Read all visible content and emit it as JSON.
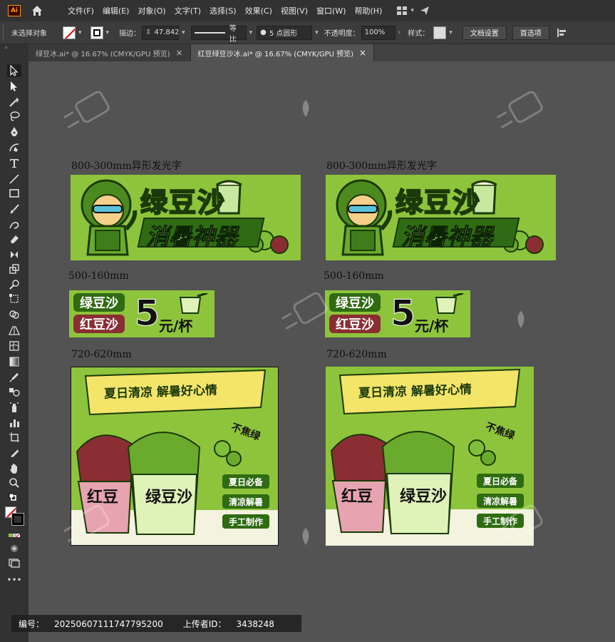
{
  "menubar": {
    "app_logo": "Ai",
    "items": [
      "文件(F)",
      "编辑(E)",
      "对象(O)",
      "文字(T)",
      "选择(S)",
      "效果(C)",
      "视图(V)",
      "窗口(W)",
      "帮助(H)"
    ]
  },
  "controlbar": {
    "selection_status": "未选择对象",
    "stroke_label": "描边：",
    "stroke_value": "47.842",
    "profile_label": "等比",
    "brush_label": "5 点圆形",
    "opacity_label": "不透明度：",
    "opacity_value": "100%",
    "style_label": "样式：",
    "doc_settings": "文档设置",
    "preferences": "首选项"
  },
  "tabs": [
    {
      "label": "绿豆冰.ai* @ 16.67% (CMYK/GPU 预览)",
      "close": "×"
    },
    {
      "label": "红豆绿豆沙冰.ai* @ 16.67% (CMYK/GPU 预览)",
      "close": "×"
    }
  ],
  "artwork": {
    "labels": {
      "banner_size_left": "800-300mm异形发光字",
      "banner_size_right": "800-300mm异形发光字",
      "small_size_left": "500-160mm",
      "small_size_right": "500-160mm",
      "poster_size_left": "720-620mm",
      "poster_size_right": "720-620mm"
    },
    "banner": {
      "title": "绿豆沙",
      "subtitle": "消暑神器"
    },
    "small_sign": {
      "line1": "绿豆沙",
      "line2": "红豆沙",
      "price": "5",
      "unit": "元/杯"
    },
    "poster": {
      "ribbon": "夏日清凉 解暑好心情",
      "tag": "不焦绿",
      "cup_red": "红豆",
      "cup_green": "绿豆沙",
      "features": [
        "夏日必备",
        "清凉解暑",
        "手工制作"
      ]
    }
  },
  "footer": {
    "id_label": "编号：",
    "id_value": "20250607111747795200",
    "uploader_label": "上传者ID：",
    "uploader_value": "3438248"
  },
  "colors": {
    "green": "#8ec43b",
    "dark_green": "#2f6b12",
    "red_bean": "#8a2e34",
    "ribbon_yellow": "#f3e46a"
  },
  "icons": [
    "home-icon",
    "arrange-icon",
    "selection-tool-icon",
    "direct-selection-tool-icon",
    "magic-wand-icon",
    "lasso-icon",
    "pen-icon",
    "curvature-icon",
    "type-icon",
    "line-icon",
    "rectangle-icon",
    "paintbrush-icon",
    "shaper-icon",
    "eraser-icon",
    "rotate-icon",
    "scale-icon",
    "warp-icon",
    "free-transform-icon",
    "shape-builder-icon",
    "perspective-icon",
    "mesh-icon",
    "gradient-icon",
    "eyedropper-icon",
    "blend-icon",
    "symbol-sprayer-icon",
    "graph-icon",
    "artboard-icon",
    "slice-icon",
    "hand-icon",
    "zoom-icon"
  ]
}
